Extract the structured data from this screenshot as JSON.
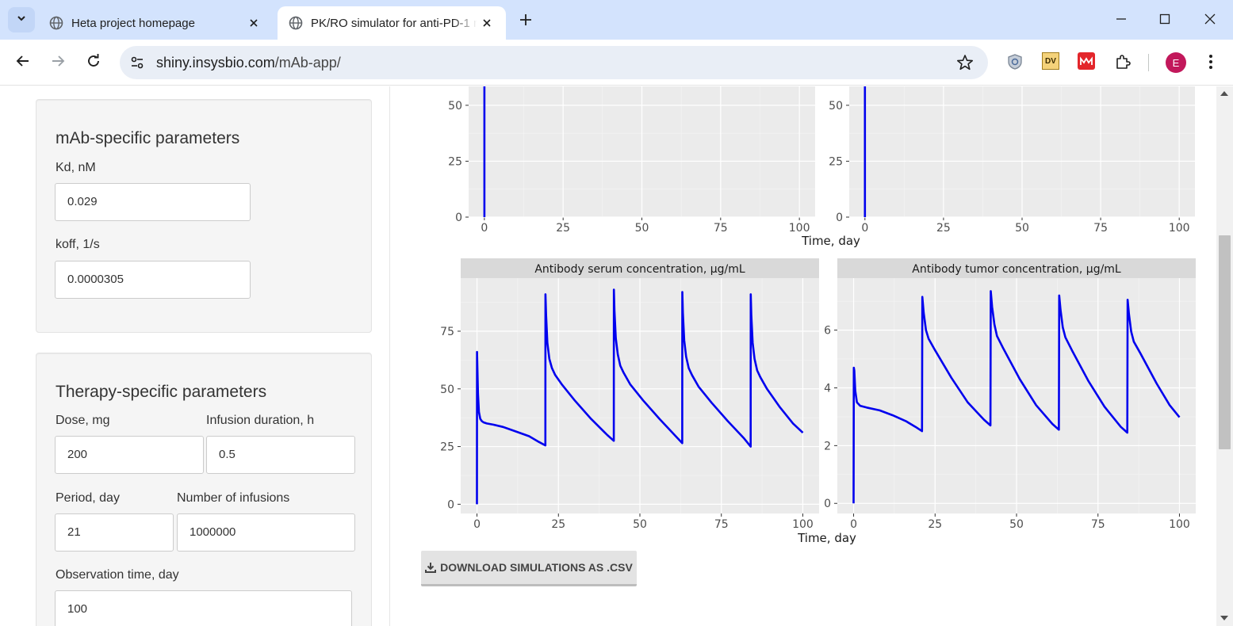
{
  "browser": {
    "tabs": [
      {
        "title": "Heta project homepage"
      },
      {
        "title": "PK/RO simulator for anti-PD-1 mAb"
      }
    ],
    "url_host": "shiny.insysbio.com",
    "url_path": "/mAb-app/",
    "ext_dv_label": "DV",
    "avatar_letter": "E"
  },
  "mab_panel": {
    "title": "mAb-specific parameters",
    "kd_label": "Kd, nM",
    "kd_value": "0.029",
    "koff_label": "koff, 1/s",
    "koff_value": "0.0000305"
  },
  "therapy_panel": {
    "title": "Therapy-specific parameters",
    "dose_label": "Dose, mg",
    "dose_value": "200",
    "infusion_label": "Infusion duration, h",
    "infusion_value": "0.5",
    "period_label": "Period, day",
    "period_value": "21",
    "num_label": "Number of infusions",
    "num_value": "1000000",
    "obs_label": "Observation time, day",
    "obs_value": "100"
  },
  "download_button": "DOWNLOAD SIMULATIONS AS .CSV",
  "colors": {
    "line": "#0000ee",
    "panel_bg": "#ebebeb",
    "strip_bg": "#d9d9d9"
  },
  "chart_data": [
    {
      "type": "line",
      "title": "",
      "xlabel": "Time, day",
      "x_ticks": [
        0,
        25,
        50,
        75,
        100
      ],
      "y_ticks": [
        0,
        25,
        50
      ],
      "xlim": [
        -5,
        105
      ],
      "ylim": [
        0,
        62
      ],
      "note": "partially scrolled; top cut off",
      "series": [
        {
          "x": [
            0,
            0
          ],
          "y": [
            0,
            62
          ]
        }
      ]
    },
    {
      "type": "line",
      "title": "",
      "xlabel": "Time, day",
      "x_ticks": [
        0,
        25,
        50,
        75,
        100
      ],
      "y_ticks": [
        0,
        25,
        50
      ],
      "xlim": [
        -5,
        105
      ],
      "ylim": [
        0,
        62
      ],
      "series": [
        {
          "x": [
            0,
            0
          ],
          "y": [
            0,
            62
          ]
        }
      ]
    },
    {
      "type": "line",
      "title": "Antibody serum concentration, µg/mL",
      "xlabel": "Time, day",
      "x_ticks": [
        0,
        25,
        50,
        75,
        100
      ],
      "y_ticks": [
        0,
        25,
        50,
        75
      ],
      "xlim": [
        -5,
        105
      ],
      "ylim": [
        -4,
        98
      ],
      "series": [
        {
          "x": [
            0,
            0.02,
            0.1,
            0.3,
            0.6,
            1,
            1.5,
            2,
            3,
            5,
            8,
            12,
            16,
            19,
            21,
            21.02,
            21.2,
            21.6,
            22.2,
            23,
            24,
            26,
            30,
            35,
            40,
            42,
            42.02,
            42.2,
            42.6,
            43.2,
            44,
            45,
            47,
            51,
            56,
            61,
            63,
            63.02,
            63.2,
            63.6,
            64.2,
            65,
            66,
            68,
            72,
            77,
            82,
            84,
            84.02,
            84.2,
            84.6,
            85.2,
            86,
            87,
            89,
            93,
            97,
            100
          ],
          "y": [
            0,
            66,
            60,
            48,
            40,
            37,
            36,
            35.5,
            35,
            34.5,
            33.5,
            31.5,
            29.5,
            27,
            25.5,
            91,
            82,
            70,
            63,
            59,
            56,
            52,
            45,
            37,
            30,
            27.5,
            93,
            84,
            72,
            65,
            60,
            57,
            52,
            45,
            37,
            29.5,
            26.5,
            92,
            83,
            71,
            64,
            59,
            56,
            51,
            44,
            36,
            28.5,
            25,
            91,
            82,
            70,
            63,
            58,
            55,
            50,
            42,
            35,
            31
          ]
        }
      ]
    },
    {
      "type": "line",
      "title": "Antibody tumor concentration, µg/mL",
      "xlabel": "Time, day",
      "x_ticks": [
        0,
        25,
        50,
        75,
        100
      ],
      "y_ticks": [
        0,
        2,
        4,
        6
      ],
      "xlim": [
        -5,
        105
      ],
      "ylim": [
        -0.35,
        7.8
      ],
      "series": [
        {
          "x": [
            0,
            0.05,
            0.2,
            0.5,
            1,
            2,
            4,
            8,
            12,
            16,
            19,
            21,
            21.1,
            21.5,
            22.2,
            23,
            25,
            30,
            35,
            40,
            42,
            42.1,
            42.5,
            43.2,
            44,
            46,
            51,
            56,
            61,
            63,
            63.1,
            63.5,
            64.2,
            65,
            67,
            72,
            77,
            82,
            84,
            84.1,
            84.5,
            85.2,
            86,
            88,
            93,
            97,
            100
          ],
          "y": [
            0,
            4.7,
            4.6,
            3.9,
            3.5,
            3.38,
            3.32,
            3.22,
            3.05,
            2.85,
            2.65,
            2.5,
            7.15,
            6.6,
            6.0,
            5.7,
            5.3,
            4.35,
            3.5,
            2.9,
            2.7,
            7.35,
            6.8,
            6.2,
            5.8,
            5.35,
            4.3,
            3.4,
            2.75,
            2.55,
            7.2,
            6.7,
            6.1,
            5.75,
            5.3,
            4.25,
            3.35,
            2.65,
            2.45,
            7.05,
            6.55,
            5.95,
            5.6,
            5.2,
            4.15,
            3.4,
            2.98
          ]
        }
      ]
    }
  ]
}
